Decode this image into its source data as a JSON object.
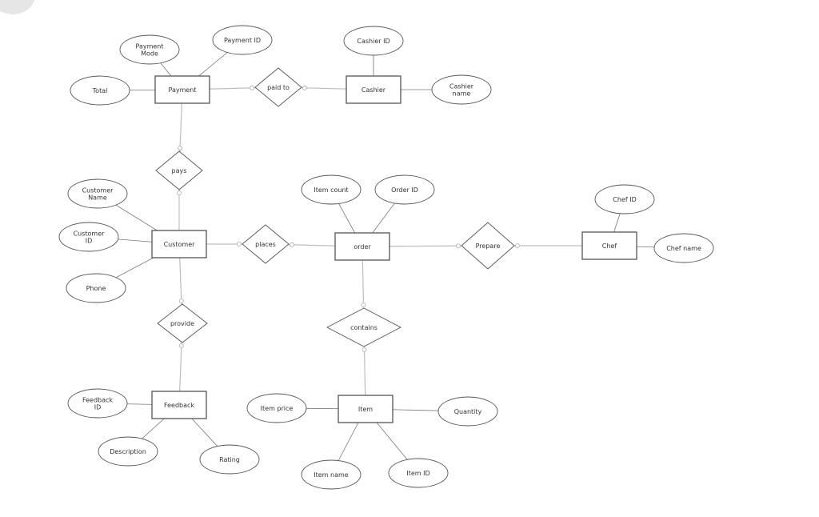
{
  "colors": {
    "shape_stroke": "#555555",
    "relation_line": "#bdbdbd",
    "attr_line": "#777777"
  },
  "entities": [
    {
      "id": "payment",
      "label": "Payment"
    },
    {
      "id": "cashier",
      "label": "Cashier"
    },
    {
      "id": "customer",
      "label": "Customer"
    },
    {
      "id": "order",
      "label": "order"
    },
    {
      "id": "chef",
      "label": "Chef"
    },
    {
      "id": "feedback",
      "label": "Feedback"
    },
    {
      "id": "item",
      "label": "Item"
    }
  ],
  "relationships": [
    {
      "id": "paid_to",
      "label": "paid to",
      "connects": [
        "payment",
        "cashier"
      ]
    },
    {
      "id": "pays",
      "label": "pays",
      "connects": [
        "payment",
        "customer"
      ]
    },
    {
      "id": "places",
      "label": "places",
      "connects": [
        "customer",
        "order"
      ]
    },
    {
      "id": "prepare",
      "label": "Prepare",
      "connects": [
        "order",
        "chef"
      ]
    },
    {
      "id": "provide",
      "label": "provide",
      "connects": [
        "customer",
        "feedback"
      ]
    },
    {
      "id": "contains",
      "label": "contains",
      "connects": [
        "order",
        "item"
      ]
    }
  ],
  "attributes": [
    {
      "id": "payment_mode",
      "label": [
        "Payment",
        "Mode"
      ],
      "entity": "payment"
    },
    {
      "id": "payment_id",
      "label": [
        "Payment ID"
      ],
      "entity": "payment"
    },
    {
      "id": "total",
      "label": [
        "Total"
      ],
      "entity": "payment"
    },
    {
      "id": "cashier_id",
      "label": [
        "Cashier ID"
      ],
      "entity": "cashier"
    },
    {
      "id": "cashier_name",
      "label": [
        "Cashier",
        "name"
      ],
      "entity": "cashier"
    },
    {
      "id": "customer_name",
      "label": [
        "Customer",
        "Name"
      ],
      "entity": "customer"
    },
    {
      "id": "customer_id",
      "label": [
        "Customer",
        "ID"
      ],
      "entity": "customer"
    },
    {
      "id": "phone",
      "label": [
        "Phone"
      ],
      "entity": "customer"
    },
    {
      "id": "item_count",
      "label": [
        "Item count"
      ],
      "entity": "order"
    },
    {
      "id": "order_id",
      "label": [
        "Order ID"
      ],
      "entity": "order"
    },
    {
      "id": "chef_id",
      "label": [
        "Chef ID"
      ],
      "entity": "chef"
    },
    {
      "id": "chef_name",
      "label": [
        "Chef name"
      ],
      "entity": "chef"
    },
    {
      "id": "feedback_id",
      "label": [
        "Feedback",
        "ID"
      ],
      "entity": "feedback"
    },
    {
      "id": "description",
      "label": [
        "Description"
      ],
      "entity": "feedback"
    },
    {
      "id": "rating",
      "label": [
        "Rating"
      ],
      "entity": "feedback"
    },
    {
      "id": "item_price",
      "label": [
        "Item price"
      ],
      "entity": "item"
    },
    {
      "id": "quantity",
      "label": [
        "Quantity"
      ],
      "entity": "item"
    },
    {
      "id": "item_name",
      "label": [
        "Item name"
      ],
      "entity": "item"
    },
    {
      "id": "item_id",
      "label": [
        "Item ID"
      ],
      "entity": "item"
    }
  ]
}
